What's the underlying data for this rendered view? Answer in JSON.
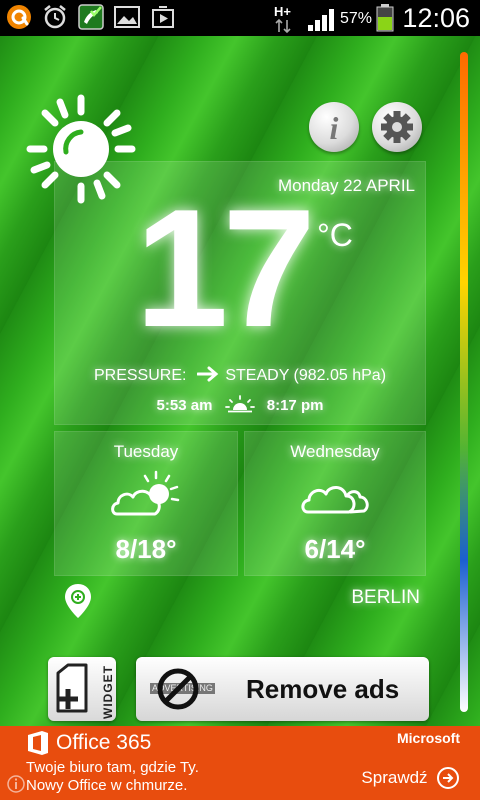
{
  "status_bar": {
    "network": "H+",
    "battery": "57%",
    "time": "12:06",
    "icons": [
      "avast-icon",
      "alarm-clock-icon",
      "phone-check-icon",
      "gallery-icon",
      "play-store-icon",
      "signal-icon",
      "battery-icon"
    ]
  },
  "weather": {
    "date": "Monday  22 APRIL",
    "temperature": "17",
    "unit": "°C",
    "pressure_label": "PRESSURE:",
    "pressure_value": "STEADY (982.05 hPa)",
    "sunrise": "5:53 am",
    "sunset": "8:17 pm"
  },
  "forecast": [
    {
      "day": "Tuesday",
      "temps": "8/18°",
      "icon": "partly-sunny-cloud-icon"
    },
    {
      "day": "Wednesday",
      "temps": "6/14°",
      "icon": "cloud-icon"
    }
  ],
  "location": {
    "city": "BERLIN"
  },
  "buttons": {
    "widget_label": "WIDGET",
    "remove_ads": "Remove ads",
    "advertising_tag": "ADVERTISING"
  },
  "ad": {
    "brand": "Office 365",
    "vendor": "Microsoft",
    "line1": "Twoje biuro tam, gdzie Ty.",
    "line2": "Nowy Office w chmurze.",
    "cta": "Sprawdź"
  },
  "colors": {
    "ad_background": "#e84d0e",
    "accent_green": "#2fae1e"
  }
}
